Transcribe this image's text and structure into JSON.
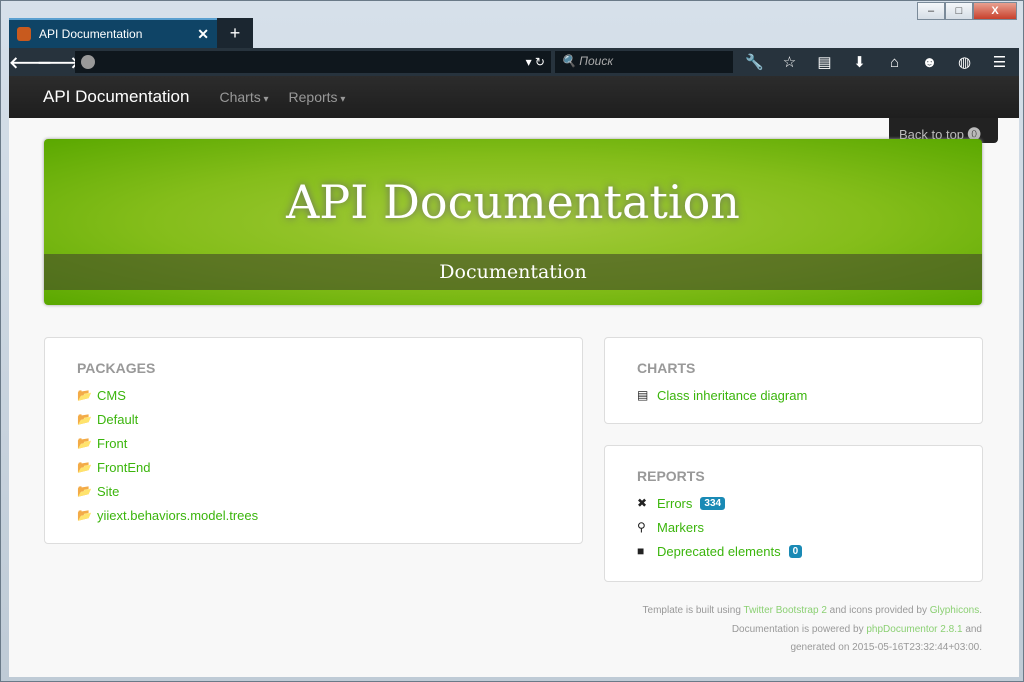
{
  "browser": {
    "tab_title": "API Documentation",
    "search_placeholder": "Поиск",
    "close": "✕",
    "newtab": "+"
  },
  "navbar": {
    "brand": "API Documentation",
    "links": [
      "Charts",
      "Reports"
    ]
  },
  "back_to_top": "Back to top",
  "banner": {
    "title": "API Documentation",
    "subtitle": "Documentation",
    "color": "#84bd1a"
  },
  "packages": {
    "heading": "PACKAGES",
    "items": [
      "CMS",
      "Default",
      "Front",
      "FrontEnd",
      "Site",
      "yiiext.behaviors.model.trees"
    ]
  },
  "charts": {
    "heading": "CHARTS",
    "items": [
      "Class inheritance diagram"
    ]
  },
  "reports": {
    "heading": "REPORTS",
    "items": [
      {
        "label": "Errors",
        "count": "334"
      },
      {
        "label": "Markers"
      },
      {
        "label": "Deprecated elements",
        "count": "0"
      }
    ]
  },
  "footer": {
    "l1a": "Template is built using",
    "l1b": "Twitter Bootstrap 2",
    "l1c": "and icons provided by",
    "l1d": "Glyphicons",
    "l1e": ".",
    "l2a": "Documentation is powered by",
    "l2b": "phpDocumentor 2.8.1",
    "l2c": "and",
    "l3": "generated on 2015-05-16T23:32:44+03:00."
  }
}
